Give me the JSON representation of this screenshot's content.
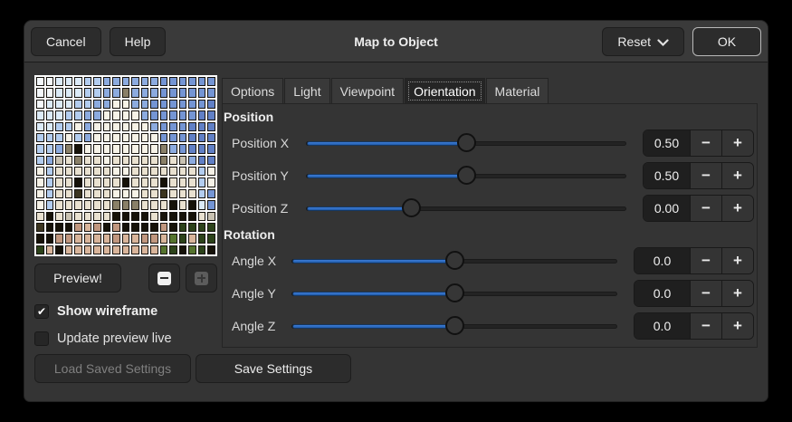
{
  "window": {
    "title": "Map to Object"
  },
  "header": {
    "cancel_label": "Cancel",
    "help_label": "Help",
    "reset_label": "Reset",
    "ok_label": "OK"
  },
  "tabs": {
    "items": [
      "Options",
      "Light",
      "Viewpoint",
      "Orientation",
      "Material"
    ],
    "active_index": 3
  },
  "preview": {
    "grid": {
      "palette": {
        "A": "#f4f8fb",
        "S": "#dcebf8",
        "P": "#b3cdef",
        "C": "#8cabdf",
        "D": "#7495d4",
        "E": "#6180c6",
        "W": "#f6f2e7",
        "w": "#e9e1d0",
        "G": "#c9c2b2",
        "M": "#8a8068",
        "K": "#161209",
        "k": "#3c3520",
        "T": "#c1977f",
        "t": "#d9b59b",
        "g": "#55732e",
        "d": "#2c421a"
      },
      "rows": [
        "AASSSPPCCCCCCDDDDDD",
        "AASSSPPCCMCCCDDDDDD",
        "ASSSPPCCWWCCDDDDDDE",
        "SSSPPCCWWWWCDDDDDEE",
        "SSPPWCWWWWWWCDDDEEE",
        "PPPWPCWWWWWWWDDDEEE",
        "PPCMKWWWWWWWWMCDEEE",
        "PCGwMwwWwwwwwMwGCEE",
        "WPwwwwwwWWwwwwwwwPW",
        "WPwwKwwwwKwwwKwwwPW",
        "WPwwkwwwWWWwwkwwwPD",
        "WPwwwwwwMMMwwwKwKSD",
        "wKwGwwwwKKKKwKKKKwG",
        "kKKKTtTKTKKKKTKdddd",
        "KKTTttttTttTTtgdtdd",
        "dtKttttttttttgdKgdK"
      ]
    },
    "preview_button_label": "Preview!",
    "checkboxes": [
      {
        "label": "Show wireframe",
        "checked": true
      },
      {
        "label": "Update preview live",
        "checked": false
      }
    ]
  },
  "panel": {
    "position": {
      "title": "Position",
      "rows": [
        {
          "label": "Position X",
          "value": "0.50",
          "fill_pct": 50
        },
        {
          "label": "Position Y",
          "value": "0.50",
          "fill_pct": 50
        },
        {
          "label": "Position Z",
          "value": "0.00",
          "fill_pct": 33
        }
      ]
    },
    "rotation": {
      "title": "Rotation",
      "rows": [
        {
          "label": "Angle X",
          "value": "0.0",
          "fill_pct": 50
        },
        {
          "label": "Angle Y",
          "value": "0.0",
          "fill_pct": 50
        },
        {
          "label": "Angle Z",
          "value": "0.0",
          "fill_pct": 50
        }
      ]
    }
  },
  "footer": {
    "load_label": "Load Saved Settings",
    "save_label": "Save Settings"
  },
  "icons": {
    "check": "✔",
    "minus": "−",
    "plus": "+"
  },
  "colors": {
    "accent_blue": "#2a66c0",
    "headerbar": "#3a3a3a",
    "body": "#343434"
  }
}
